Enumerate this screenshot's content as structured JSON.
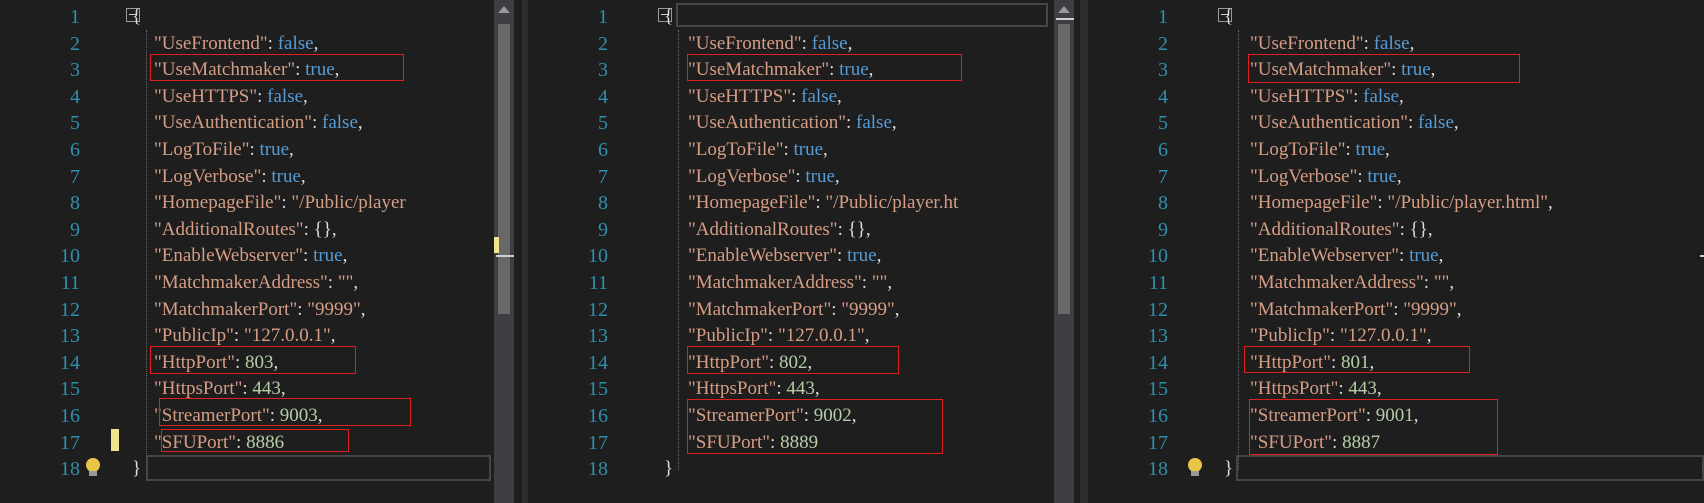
{
  "panes": [
    {
      "id": "left",
      "line_numbers": [
        "1",
        "2",
        "3",
        "4",
        "5",
        "6",
        "7",
        "8",
        "9",
        "10",
        "11",
        "12",
        "13",
        "14",
        "15",
        "16",
        "17",
        "18"
      ],
      "lines": [
        [
          [
            "punc",
            "{"
          ]
        ],
        [
          [
            "key",
            "\"UseFrontend\""
          ],
          [
            "punc",
            ": "
          ],
          [
            "bool",
            "false"
          ],
          [
            "punc",
            ","
          ]
        ],
        [
          [
            "key",
            "\"UseMatchmaker\""
          ],
          [
            "punc",
            ": "
          ],
          [
            "bool",
            "true"
          ],
          [
            "punc",
            ","
          ]
        ],
        [
          [
            "key",
            "\"UseHTTPS\""
          ],
          [
            "punc",
            ": "
          ],
          [
            "bool",
            "false"
          ],
          [
            "punc",
            ","
          ]
        ],
        [
          [
            "key",
            "\"UseAuthentication\""
          ],
          [
            "punc",
            ": "
          ],
          [
            "bool",
            "false"
          ],
          [
            "punc",
            ","
          ]
        ],
        [
          [
            "key",
            "\"LogToFile\""
          ],
          [
            "punc",
            ": "
          ],
          [
            "bool",
            "true"
          ],
          [
            "punc",
            ","
          ]
        ],
        [
          [
            "key",
            "\"LogVerbose\""
          ],
          [
            "punc",
            ": "
          ],
          [
            "bool",
            "true"
          ],
          [
            "punc",
            ","
          ]
        ],
        [
          [
            "key",
            "\"HomepageFile\""
          ],
          [
            "punc",
            ": "
          ],
          [
            "str",
            "\"/Public/player"
          ]
        ],
        [
          [
            "key",
            "\"AdditionalRoutes\""
          ],
          [
            "punc",
            ": {},"
          ]
        ],
        [
          [
            "key",
            "\"EnableWebserver\""
          ],
          [
            "punc",
            ": "
          ],
          [
            "bool",
            "true"
          ],
          [
            "punc",
            ","
          ]
        ],
        [
          [
            "key",
            "\"MatchmakerAddress\""
          ],
          [
            "punc",
            ": "
          ],
          [
            "str",
            "\"\""
          ],
          [
            "punc",
            ","
          ]
        ],
        [
          [
            "key",
            "\"MatchmakerPort\""
          ],
          [
            "punc",
            ": "
          ],
          [
            "str",
            "\"9999\""
          ],
          [
            "punc",
            ","
          ]
        ],
        [
          [
            "key",
            "\"PublicIp\""
          ],
          [
            "punc",
            ": "
          ],
          [
            "str",
            "\"127.0.0.1\""
          ],
          [
            "punc",
            ","
          ]
        ],
        [
          [
            "key",
            "\"HttpPort\""
          ],
          [
            "punc",
            ": "
          ],
          [
            "num",
            "803"
          ],
          [
            "punc",
            ","
          ]
        ],
        [
          [
            "key",
            "\"HttpsPort\""
          ],
          [
            "punc",
            ": "
          ],
          [
            "num",
            "443"
          ],
          [
            "punc",
            ","
          ]
        ],
        [
          [
            "key",
            "\"StreamerPort\""
          ],
          [
            "punc",
            ": "
          ],
          [
            "num",
            "9003"
          ],
          [
            "punc",
            ","
          ]
        ],
        [
          [
            "key",
            "\"SFUPort\""
          ],
          [
            "punc",
            ": "
          ],
          [
            "num",
            "8886"
          ]
        ],
        [
          [
            "punc",
            "}"
          ]
        ]
      ]
    },
    {
      "id": "middle",
      "line_numbers": [
        "1",
        "2",
        "3",
        "4",
        "5",
        "6",
        "7",
        "8",
        "9",
        "10",
        "11",
        "12",
        "13",
        "14",
        "15",
        "16",
        "17",
        "18"
      ],
      "lines": [
        [
          [
            "punc",
            "{"
          ]
        ],
        [
          [
            "key",
            "\"UseFrontend\""
          ],
          [
            "punc",
            ": "
          ],
          [
            "bool",
            "false"
          ],
          [
            "punc",
            ","
          ]
        ],
        [
          [
            "key",
            "\"UseMatchmaker\""
          ],
          [
            "punc",
            ": "
          ],
          [
            "bool",
            "true"
          ],
          [
            "punc",
            ","
          ]
        ],
        [
          [
            "key",
            "\"UseHTTPS\""
          ],
          [
            "punc",
            ": "
          ],
          [
            "bool",
            "false"
          ],
          [
            "punc",
            ","
          ]
        ],
        [
          [
            "key",
            "\"UseAuthentication\""
          ],
          [
            "punc",
            ": "
          ],
          [
            "bool",
            "false"
          ],
          [
            "punc",
            ","
          ]
        ],
        [
          [
            "key",
            "\"LogToFile\""
          ],
          [
            "punc",
            ": "
          ],
          [
            "bool",
            "true"
          ],
          [
            "punc",
            ","
          ]
        ],
        [
          [
            "key",
            "\"LogVerbose\""
          ],
          [
            "punc",
            ": "
          ],
          [
            "bool",
            "true"
          ],
          [
            "punc",
            ","
          ]
        ],
        [
          [
            "key",
            "\"HomepageFile\""
          ],
          [
            "punc",
            ": "
          ],
          [
            "str",
            "\"/Public/player.ht"
          ]
        ],
        [
          [
            "key",
            "\"AdditionalRoutes\""
          ],
          [
            "punc",
            ": {},"
          ]
        ],
        [
          [
            "key",
            "\"EnableWebserver\""
          ],
          [
            "punc",
            ": "
          ],
          [
            "bool",
            "true"
          ],
          [
            "punc",
            ","
          ]
        ],
        [
          [
            "key",
            "\"MatchmakerAddress\""
          ],
          [
            "punc",
            ": "
          ],
          [
            "str",
            "\"\""
          ],
          [
            "punc",
            ","
          ]
        ],
        [
          [
            "key",
            "\"MatchmakerPort\""
          ],
          [
            "punc",
            ": "
          ],
          [
            "str",
            "\"9999\""
          ],
          [
            "punc",
            ","
          ]
        ],
        [
          [
            "key",
            "\"PublicIp\""
          ],
          [
            "punc",
            ": "
          ],
          [
            "str",
            "\"127.0.0.1\""
          ],
          [
            "punc",
            ","
          ]
        ],
        [
          [
            "key",
            "\"HttpPort\""
          ],
          [
            "punc",
            ": "
          ],
          [
            "num",
            "802"
          ],
          [
            "punc",
            ","
          ]
        ],
        [
          [
            "key",
            "\"HttpsPort\""
          ],
          [
            "punc",
            ": "
          ],
          [
            "num",
            "443"
          ],
          [
            "punc",
            ","
          ]
        ],
        [
          [
            "key",
            "\"StreamerPort\""
          ],
          [
            "punc",
            ": "
          ],
          [
            "num",
            "9002"
          ],
          [
            "punc",
            ","
          ]
        ],
        [
          [
            "key",
            "\"SFUPort\""
          ],
          [
            "punc",
            ": "
          ],
          [
            "num",
            "8889"
          ]
        ],
        [
          [
            "punc",
            "}"
          ]
        ]
      ]
    },
    {
      "id": "right",
      "line_numbers": [
        "1",
        "2",
        "3",
        "4",
        "5",
        "6",
        "7",
        "8",
        "9",
        "10",
        "11",
        "12",
        "13",
        "14",
        "15",
        "16",
        "17",
        "18"
      ],
      "lines": [
        [
          [
            "punc",
            "{"
          ]
        ],
        [
          [
            "key",
            "\"UseFrontend\""
          ],
          [
            "punc",
            ": "
          ],
          [
            "bool",
            "false"
          ],
          [
            "punc",
            ","
          ]
        ],
        [
          [
            "key",
            "\"UseMatchmaker\""
          ],
          [
            "punc",
            ": "
          ],
          [
            "bool",
            "true"
          ],
          [
            "punc",
            ","
          ]
        ],
        [
          [
            "key",
            "\"UseHTTPS\""
          ],
          [
            "punc",
            ": "
          ],
          [
            "bool",
            "false"
          ],
          [
            "punc",
            ","
          ]
        ],
        [
          [
            "key",
            "\"UseAuthentication\""
          ],
          [
            "punc",
            ": "
          ],
          [
            "bool",
            "false"
          ],
          [
            "punc",
            ","
          ]
        ],
        [
          [
            "key",
            "\"LogToFile\""
          ],
          [
            "punc",
            ": "
          ],
          [
            "bool",
            "true"
          ],
          [
            "punc",
            ","
          ]
        ],
        [
          [
            "key",
            "\"LogVerbose\""
          ],
          [
            "punc",
            ": "
          ],
          [
            "bool",
            "true"
          ],
          [
            "punc",
            ","
          ]
        ],
        [
          [
            "key",
            "\"HomepageFile\""
          ],
          [
            "punc",
            ": "
          ],
          [
            "str",
            "\"/Public/player.html\""
          ],
          [
            "punc",
            ","
          ]
        ],
        [
          [
            "key",
            "\"AdditionalRoutes\""
          ],
          [
            "punc",
            ": {},"
          ]
        ],
        [
          [
            "key",
            "\"EnableWebserver\""
          ],
          [
            "punc",
            ": "
          ],
          [
            "bool",
            "true"
          ],
          [
            "punc",
            ","
          ]
        ],
        [
          [
            "key",
            "\"MatchmakerAddress\""
          ],
          [
            "punc",
            ": "
          ],
          [
            "str",
            "\"\""
          ],
          [
            "punc",
            ","
          ]
        ],
        [
          [
            "key",
            "\"MatchmakerPort\""
          ],
          [
            "punc",
            ": "
          ],
          [
            "str",
            "\"9999\""
          ],
          [
            "punc",
            ","
          ]
        ],
        [
          [
            "key",
            "\"PublicIp\""
          ],
          [
            "punc",
            ": "
          ],
          [
            "str",
            "\"127.0.0.1\""
          ],
          [
            "punc",
            ","
          ]
        ],
        [
          [
            "key",
            "\"HttpPort\""
          ],
          [
            "punc",
            ": "
          ],
          [
            "num",
            "801"
          ],
          [
            "punc",
            ","
          ]
        ],
        [
          [
            "key",
            "\"HttpsPort\""
          ],
          [
            "punc",
            ": "
          ],
          [
            "num",
            "443"
          ],
          [
            "punc",
            ","
          ]
        ],
        [
          [
            "key",
            "\"StreamerPort\""
          ],
          [
            "punc",
            ": "
          ],
          [
            "num",
            "9001"
          ],
          [
            "punc",
            ","
          ]
        ],
        [
          [
            "key",
            "\"SFUPort\""
          ],
          [
            "punc",
            ": "
          ],
          [
            "num",
            "8887"
          ]
        ],
        [
          [
            "punc",
            "}"
          ]
        ]
      ]
    }
  ],
  "icons": {
    "fold": "collapse-region-icon",
    "bulb": "lightbulb-icon"
  },
  "colors": {
    "editor_bg": "#1e1e1e",
    "line_number": "#2b91af",
    "string": "#d69d85",
    "keyword": "#569cd6",
    "number": "#b5cea8",
    "highlight_box": "#e02020"
  }
}
